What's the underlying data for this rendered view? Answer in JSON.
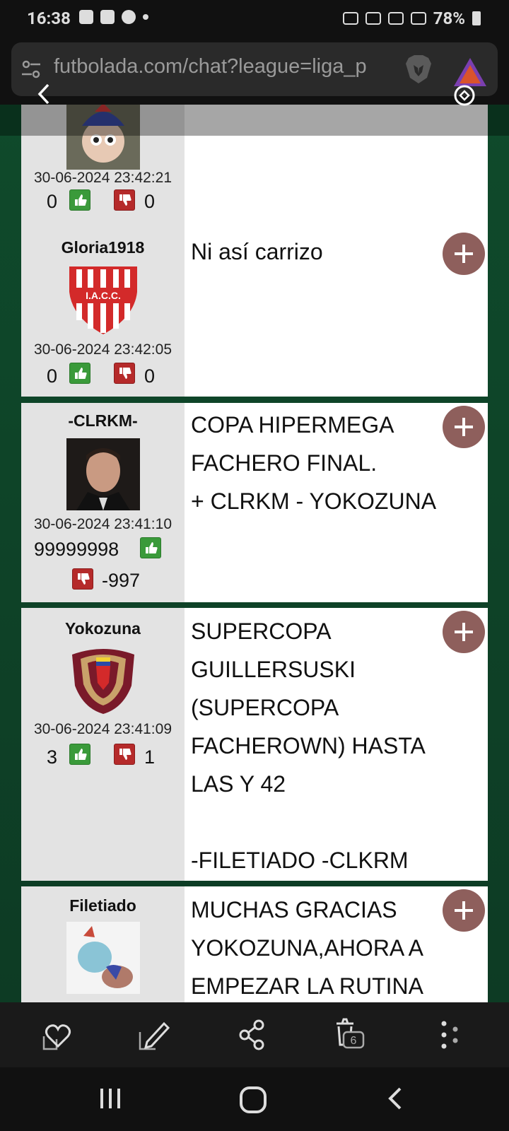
{
  "status_bar": {
    "time": "16:38",
    "battery": "78%"
  },
  "browser": {
    "url": "futbolada.com/chat?league=liga_p"
  },
  "posts": [
    {
      "user": "",
      "date": "30-06-2024 23:42:21",
      "likes": "0",
      "dislikes": "0",
      "message": ""
    },
    {
      "user": "Gloria1918",
      "date": "30-06-2024 23:42:05",
      "likes": "0",
      "dislikes": "0",
      "message": "Ni así carrizo"
    },
    {
      "user": "-CLRKM-",
      "date": "30-06-2024 23:41:10",
      "likes": "99999998",
      "dislikes": "-997",
      "message": "COPA HIPERMEGA\nFACHERO FINAL.\n+ CLRKM - YOKOZUNA"
    },
    {
      "user": "Yokozuna",
      "date": "30-06-2024 23:41:09",
      "likes": "3",
      "dislikes": "1",
      "message": "SUPERCOPA\nGUILLERSUSKI\n(SUPERCOPA\nFACHEROWN) HASTA\nLAS Y 42\n\n-FILETIADO -CLKRM"
    },
    {
      "user": "Filetiado",
      "date": "",
      "likes": "",
      "dislikes": "",
      "message": "MUCHAS GRACIAS\nYOKOZUNA,AHORA A\nEMPEZAR LA RUTINA"
    }
  ],
  "toolbar": {
    "tab_count": "6"
  },
  "icons": [
    "tune-icon",
    "brave-lion-icon",
    "triangle-rewards-icon",
    "back-icon",
    "sync-icon",
    "thumbs-up-icon",
    "thumbs-down-icon",
    "plus-icon",
    "heart-home-icon",
    "edit-icon",
    "share-icon",
    "delete-icon",
    "menu-dots-icon"
  ],
  "colors": {
    "page_bg": "#0f3a24",
    "side_bg": "#e3e3e3",
    "plus_bg": "#8e5f5c",
    "like": "#3a9a3a",
    "dislike": "#b52a2a"
  }
}
